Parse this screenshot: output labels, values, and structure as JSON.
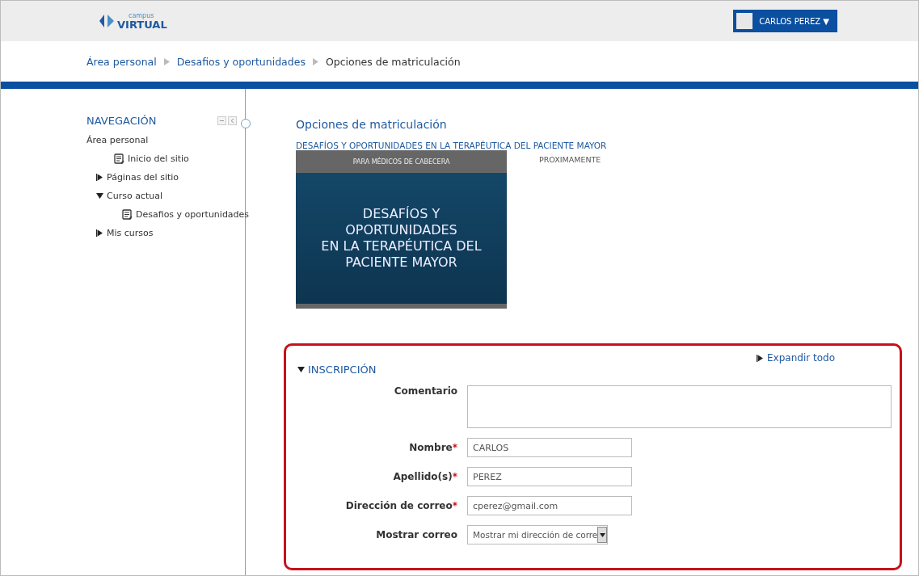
{
  "header": {
    "logo": {
      "small": "campus",
      "main": "VIRTUAL"
    },
    "user_menu": {
      "name": "CARLOS PEREZ",
      "caret": "▼"
    }
  },
  "breadcrumb": [
    {
      "label": "Área personal",
      "link": true
    },
    {
      "label": "Desafios y oportunidades",
      "link": true
    },
    {
      "label": "Opciones de matriculación",
      "link": false
    }
  ],
  "navigation": {
    "title": "NAVEGACIÓN",
    "items": [
      {
        "label": "Área personal",
        "kind": "root",
        "children": [
          {
            "label": "Inicio del sitio",
            "kind": "page"
          },
          {
            "label": "Páginas del sitio",
            "kind": "branch",
            "expanded": false
          },
          {
            "label": "Curso actual",
            "kind": "branch",
            "expanded": true,
            "children": [
              {
                "label": "Desafios y oportunidades",
                "kind": "page"
              }
            ]
          },
          {
            "label": "Mis cursos",
            "kind": "branch",
            "expanded": false
          }
        ]
      }
    ]
  },
  "main": {
    "title": "Opciones de matriculación",
    "course": {
      "name": "DESAFÍOS Y OPORTUNIDADES EN LA TERAPÉUTICA DEL PACIENTE MAYOR",
      "status": "PROXIMAMENTE",
      "banner": {
        "top": "PARA MÉDICOS DE CABECERA",
        "lines": [
          "DESAFÍOS Y",
          "OPORTUNIDADES",
          "EN LA TERAPÉUTICA DEL",
          "PACIENTE MAYOR"
        ]
      }
    },
    "form": {
      "expand_all": "Expandir todo",
      "section": {
        "title": "INSCRIPCIÓN",
        "expanded": true
      },
      "fields": [
        {
          "kind": "textarea",
          "label": "Comentario"
        },
        {
          "kind": "text",
          "label": "Nombre",
          "required_mark": "*",
          "value": "CARLOS"
        },
        {
          "kind": "text",
          "label": "Apellido(s)",
          "required_mark": "*",
          "value": "PEREZ"
        },
        {
          "kind": "text",
          "label": "Dirección de correo",
          "required_mark": "*",
          "value": "cperez@gmail.com"
        },
        {
          "kind": "select",
          "label": "Mostrar correo",
          "value": "Mostrar mi dirección de corre"
        }
      ]
    }
  }
}
